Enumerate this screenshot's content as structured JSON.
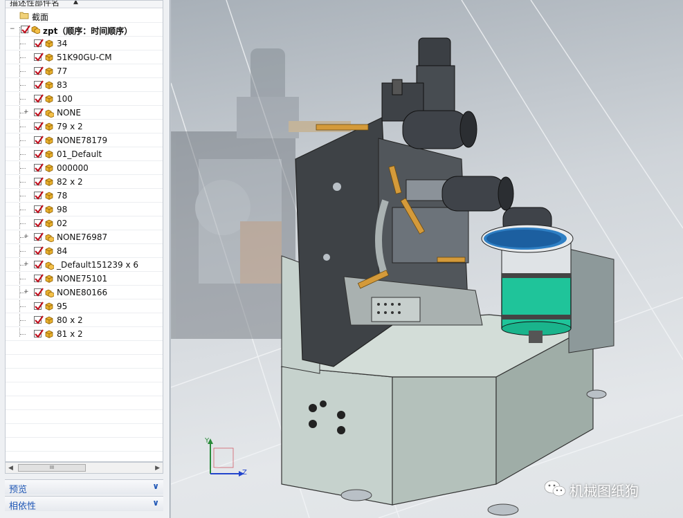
{
  "tree": {
    "column_header": "描述性部件名",
    "section_item": "截面",
    "root_label": "zpt（顺序：时间顺序）",
    "items": [
      {
        "label": "34",
        "expandable": false
      },
      {
        "label": "51K90GU-CM",
        "expandable": false
      },
      {
        "label": "77",
        "expandable": false
      },
      {
        "label": "83",
        "expandable": false
      },
      {
        "label": "100",
        "expandable": false
      },
      {
        "label": "NONE",
        "expandable": true
      },
      {
        "label": "79 x 2",
        "expandable": false
      },
      {
        "label": "NONE78179",
        "expandable": false
      },
      {
        "label": "01_Default",
        "expandable": false
      },
      {
        "label": "000000",
        "expandable": false
      },
      {
        "label": "82 x 2",
        "expandable": false
      },
      {
        "label": "78",
        "expandable": false
      },
      {
        "label": "98",
        "expandable": false
      },
      {
        "label": "02",
        "expandable": false
      },
      {
        "label": "NONE76987",
        "expandable": true
      },
      {
        "label": "84",
        "expandable": false
      },
      {
        "label": "_Default151239 x 6",
        "expandable": true
      },
      {
        "label": "NONE75101",
        "expandable": false
      },
      {
        "label": "NONE80166",
        "expandable": true
      },
      {
        "label": "95",
        "expandable": false
      },
      {
        "label": "80 x 2",
        "expandable": false
      },
      {
        "label": "81 x 2",
        "expandable": false
      }
    ],
    "scroll_thumb_grip": "III"
  },
  "sections": {
    "preview": "预览",
    "dependencies": "相依性"
  },
  "triad": {
    "y_label": "Y",
    "z_label": "Z"
  },
  "watermark": {
    "text": "机械图纸狗"
  },
  "colors": {
    "accent": "#1e56b5",
    "check": "#c0111f",
    "cube": "#e8b02e",
    "bowl": "#1fc49a"
  }
}
